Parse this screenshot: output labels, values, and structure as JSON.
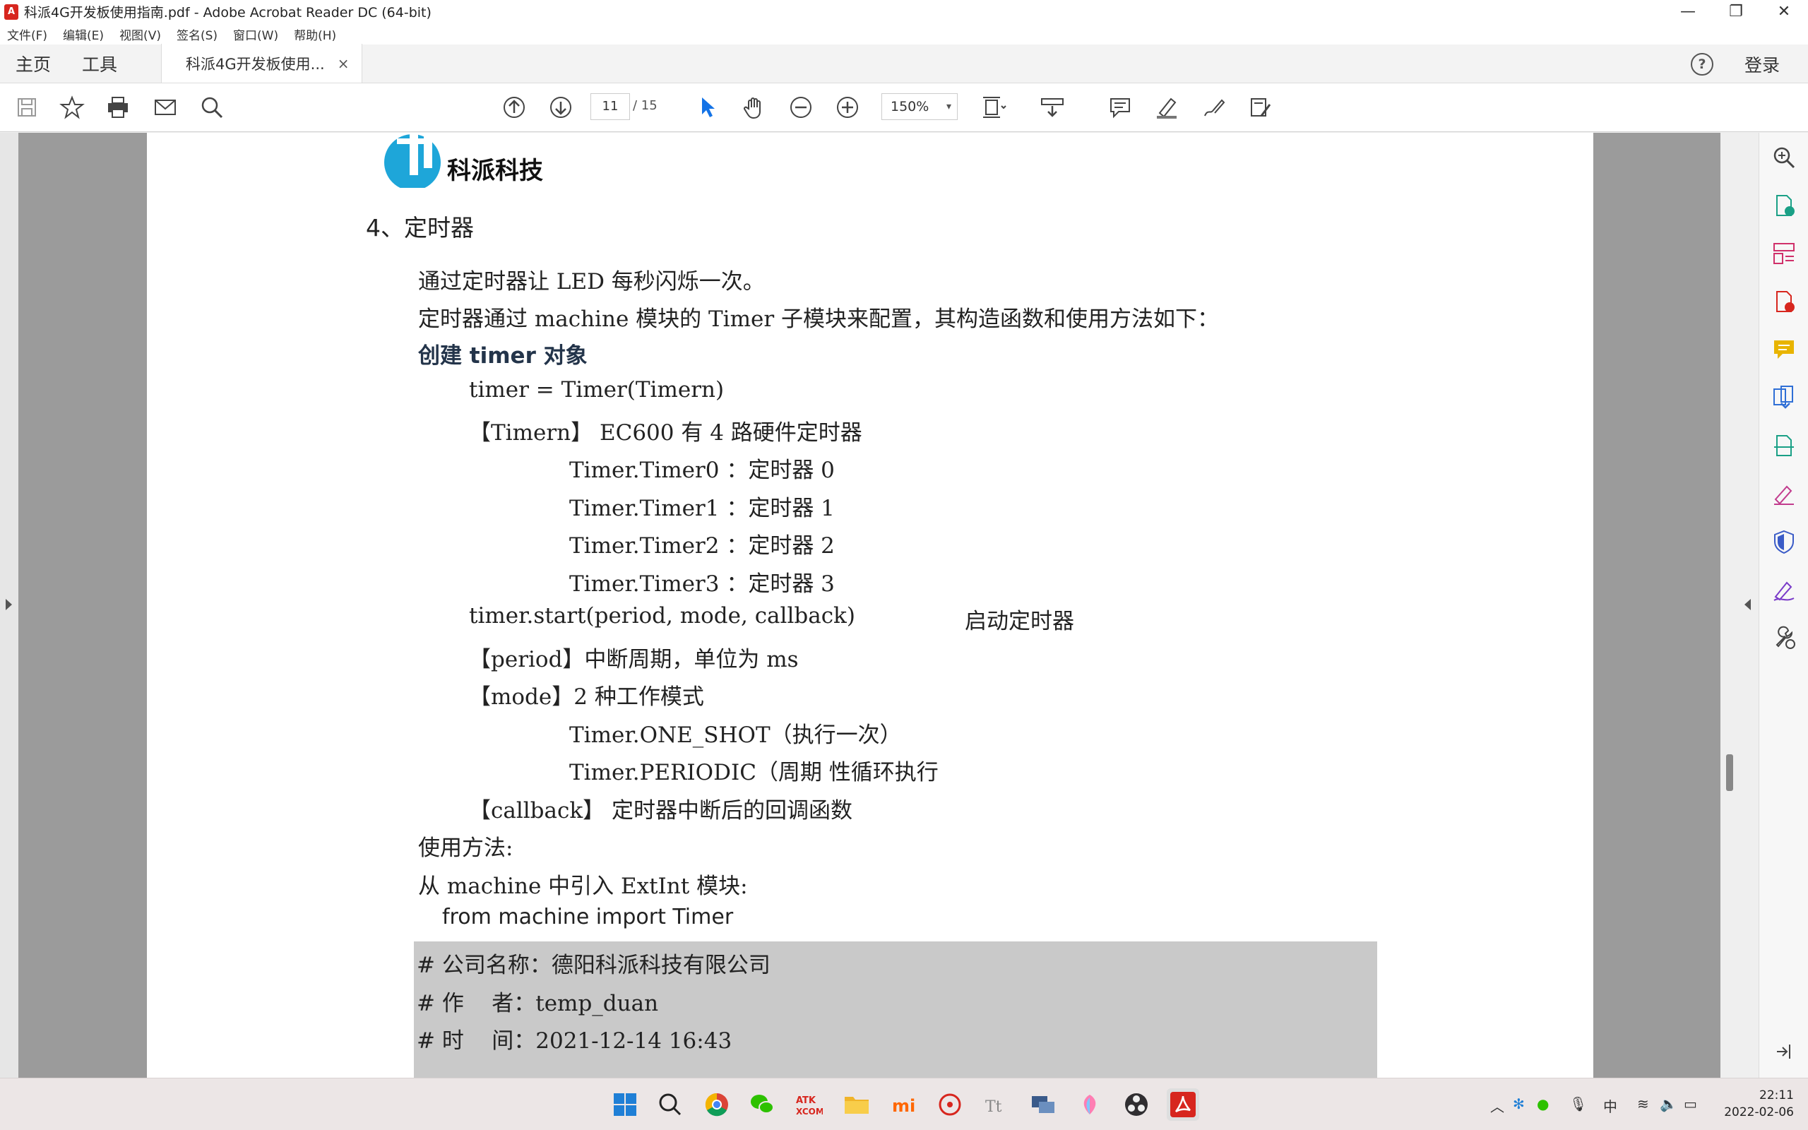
{
  "window": {
    "title": "科派4G开发板使用指南.pdf - Adobe Acrobat Reader DC (64-bit)",
    "minimize": "—",
    "restore": "❐",
    "close": "✕"
  },
  "menu": [
    "文件(F)",
    "编辑(E)",
    "视图(V)",
    "签名(S)",
    "窗口(W)",
    "帮助(H)"
  ],
  "tabs": {
    "home": "主页",
    "tools": "工具",
    "doc": "科派4G开发板使用...",
    "doc_close": "×",
    "help": "?",
    "login": "登录"
  },
  "toolbar": {
    "page_current": "11",
    "page_total": "/ 15",
    "zoom": "150%",
    "zoom_caret": "▾"
  },
  "document": {
    "logo_text": "科派科技",
    "lines": [
      "4、定时器",
      "通过定时器让 LED 每秒闪烁一次。",
      "定时器通过 machine 模块的 Timer 子模块来配置，其构造函数和使用方法如下：",
      "创建 timer 对象",
      "timer = Timer(Timern)",
      "【Timern】 EC600 有 4 路硬件定时器",
      "Timer.Timer0 ：定时器 0",
      "Timer.Timer1 ：定时器 1",
      "Timer.Timer2 ：定时器 2",
      "Timer.Timer3 ：定时器 3",
      "timer.start(period, mode, callback)",
      "启动定时器",
      "【period】中断周期，单位为 ms",
      "【mode】2 种工作模式",
      "Timer.ONE_SHOT（执行一次）",
      "Timer.PERIODIC（周期 性循环执行",
      "【callback】 定时器中断后的回调函数",
      "使用方法:",
      "从 machine 中引入 ExtInt 模块:",
      "from machine import Timer",
      "# 公司名称：德阳科派科技有限公司",
      "# 作    者：temp_duan",
      "# 时    间：2021-12-14 16:43"
    ]
  },
  "taskbar": {
    "ime": "中",
    "time": "22:11",
    "date": "2022-02-06"
  },
  "colors": {
    "accent_red": "#d7261e",
    "select_blue": "#1473e6",
    "page_bg": "#9b9b9b",
    "code_bg": "#c9c9c9"
  },
  "icons": [
    "save-icon",
    "bookmark-star-icon",
    "print-icon",
    "email-icon",
    "search-icon",
    "prev-page-icon",
    "next-page-icon",
    "select-cursor-icon",
    "hand-icon",
    "zoom-out-icon",
    "zoom-in-icon",
    "page-fit-icon",
    "scroll-mode-icon",
    "comment-icon",
    "highlight-icon",
    "sign-icon",
    "redact-icon"
  ]
}
